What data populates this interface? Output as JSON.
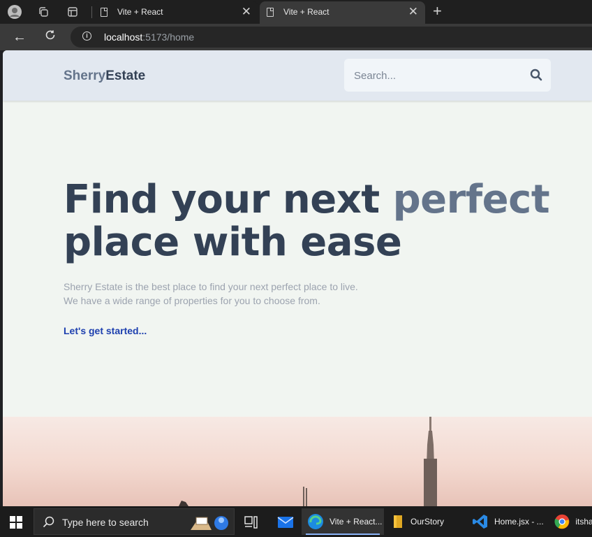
{
  "browser": {
    "tabs": [
      {
        "title": "Vite + React",
        "active": false
      },
      {
        "title": "Vite + React",
        "active": true
      }
    ],
    "address": {
      "host": "localhost",
      "rest": ":5173/home"
    }
  },
  "site": {
    "logo": {
      "part1": "Sherry",
      "part2": "Estate"
    },
    "search": {
      "placeholder": "Search..."
    },
    "hero": {
      "title_line1": "Find your next ",
      "title_accent": "perfect",
      "title_line2": "place with ease",
      "subtitle_line1": "Sherry Estate is the best place to find your next perfect place to live.",
      "subtitle_line2": "We have a wide range of properties for you to choose from.",
      "cta": "Let's get started..."
    }
  },
  "taskbar": {
    "search_placeholder": "Type here to search",
    "items": [
      {
        "label": "Vite + React..."
      },
      {
        "label": "OurStory"
      },
      {
        "label": "Home.jsx - ..."
      },
      {
        "label": "itsha"
      }
    ]
  },
  "colors": {
    "header_bg": "#e2e8f0",
    "page_bg": "#f1f5f1",
    "title": "#334155",
    "accent": "#64748b",
    "link": "#1e40af"
  }
}
